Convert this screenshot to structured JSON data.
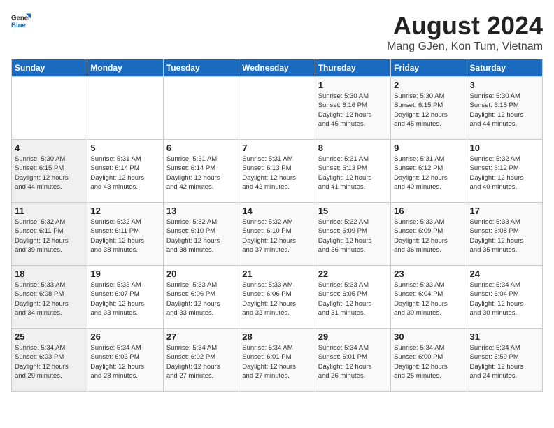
{
  "header": {
    "logo_general": "General",
    "logo_blue": "Blue",
    "month_title": "August 2024",
    "location": "Mang GJen, Kon Tum, Vietnam"
  },
  "weekdays": [
    "Sunday",
    "Monday",
    "Tuesday",
    "Wednesday",
    "Thursday",
    "Friday",
    "Saturday"
  ],
  "weeks": [
    [
      {
        "day": "",
        "detail": ""
      },
      {
        "day": "",
        "detail": ""
      },
      {
        "day": "",
        "detail": ""
      },
      {
        "day": "",
        "detail": ""
      },
      {
        "day": "1",
        "detail": "Sunrise: 5:30 AM\nSunset: 6:16 PM\nDaylight: 12 hours\nand 45 minutes."
      },
      {
        "day": "2",
        "detail": "Sunrise: 5:30 AM\nSunset: 6:15 PM\nDaylight: 12 hours\nand 45 minutes."
      },
      {
        "day": "3",
        "detail": "Sunrise: 5:30 AM\nSunset: 6:15 PM\nDaylight: 12 hours\nand 44 minutes."
      }
    ],
    [
      {
        "day": "4",
        "detail": "Sunrise: 5:30 AM\nSunset: 6:15 PM\nDaylight: 12 hours\nand 44 minutes."
      },
      {
        "day": "5",
        "detail": "Sunrise: 5:31 AM\nSunset: 6:14 PM\nDaylight: 12 hours\nand 43 minutes."
      },
      {
        "day": "6",
        "detail": "Sunrise: 5:31 AM\nSunset: 6:14 PM\nDaylight: 12 hours\nand 42 minutes."
      },
      {
        "day": "7",
        "detail": "Sunrise: 5:31 AM\nSunset: 6:13 PM\nDaylight: 12 hours\nand 42 minutes."
      },
      {
        "day": "8",
        "detail": "Sunrise: 5:31 AM\nSunset: 6:13 PM\nDaylight: 12 hours\nand 41 minutes."
      },
      {
        "day": "9",
        "detail": "Sunrise: 5:31 AM\nSunset: 6:12 PM\nDaylight: 12 hours\nand 40 minutes."
      },
      {
        "day": "10",
        "detail": "Sunrise: 5:32 AM\nSunset: 6:12 PM\nDaylight: 12 hours\nand 40 minutes."
      }
    ],
    [
      {
        "day": "11",
        "detail": "Sunrise: 5:32 AM\nSunset: 6:11 PM\nDaylight: 12 hours\nand 39 minutes."
      },
      {
        "day": "12",
        "detail": "Sunrise: 5:32 AM\nSunset: 6:11 PM\nDaylight: 12 hours\nand 38 minutes."
      },
      {
        "day": "13",
        "detail": "Sunrise: 5:32 AM\nSunset: 6:10 PM\nDaylight: 12 hours\nand 38 minutes."
      },
      {
        "day": "14",
        "detail": "Sunrise: 5:32 AM\nSunset: 6:10 PM\nDaylight: 12 hours\nand 37 minutes."
      },
      {
        "day": "15",
        "detail": "Sunrise: 5:32 AM\nSunset: 6:09 PM\nDaylight: 12 hours\nand 36 minutes."
      },
      {
        "day": "16",
        "detail": "Sunrise: 5:33 AM\nSunset: 6:09 PM\nDaylight: 12 hours\nand 36 minutes."
      },
      {
        "day": "17",
        "detail": "Sunrise: 5:33 AM\nSunset: 6:08 PM\nDaylight: 12 hours\nand 35 minutes."
      }
    ],
    [
      {
        "day": "18",
        "detail": "Sunrise: 5:33 AM\nSunset: 6:08 PM\nDaylight: 12 hours\nand 34 minutes."
      },
      {
        "day": "19",
        "detail": "Sunrise: 5:33 AM\nSunset: 6:07 PM\nDaylight: 12 hours\nand 33 minutes."
      },
      {
        "day": "20",
        "detail": "Sunrise: 5:33 AM\nSunset: 6:06 PM\nDaylight: 12 hours\nand 33 minutes."
      },
      {
        "day": "21",
        "detail": "Sunrise: 5:33 AM\nSunset: 6:06 PM\nDaylight: 12 hours\nand 32 minutes."
      },
      {
        "day": "22",
        "detail": "Sunrise: 5:33 AM\nSunset: 6:05 PM\nDaylight: 12 hours\nand 31 minutes."
      },
      {
        "day": "23",
        "detail": "Sunrise: 5:33 AM\nSunset: 6:04 PM\nDaylight: 12 hours\nand 30 minutes."
      },
      {
        "day": "24",
        "detail": "Sunrise: 5:34 AM\nSunset: 6:04 PM\nDaylight: 12 hours\nand 30 minutes."
      }
    ],
    [
      {
        "day": "25",
        "detail": "Sunrise: 5:34 AM\nSunset: 6:03 PM\nDaylight: 12 hours\nand 29 minutes."
      },
      {
        "day": "26",
        "detail": "Sunrise: 5:34 AM\nSunset: 6:03 PM\nDaylight: 12 hours\nand 28 minutes."
      },
      {
        "day": "27",
        "detail": "Sunrise: 5:34 AM\nSunset: 6:02 PM\nDaylight: 12 hours\nand 27 minutes."
      },
      {
        "day": "28",
        "detail": "Sunrise: 5:34 AM\nSunset: 6:01 PM\nDaylight: 12 hours\nand 27 minutes."
      },
      {
        "day": "29",
        "detail": "Sunrise: 5:34 AM\nSunset: 6:01 PM\nDaylight: 12 hours\nand 26 minutes."
      },
      {
        "day": "30",
        "detail": "Sunrise: 5:34 AM\nSunset: 6:00 PM\nDaylight: 12 hours\nand 25 minutes."
      },
      {
        "day": "31",
        "detail": "Sunrise: 5:34 AM\nSunset: 5:59 PM\nDaylight: 12 hours\nand 24 minutes."
      }
    ]
  ]
}
